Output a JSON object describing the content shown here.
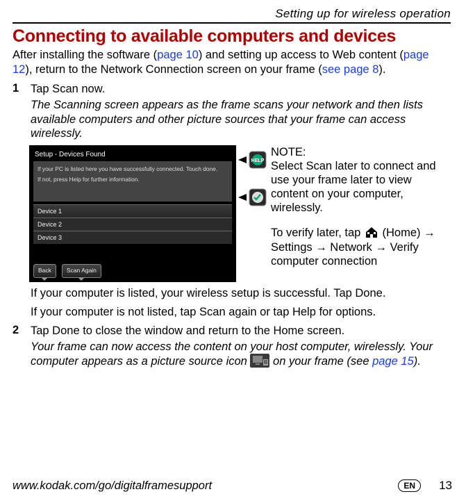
{
  "header": {
    "section": "Setting up for wireless operation"
  },
  "title": "Connecting to available computers and devices",
  "intro": {
    "pre": "After installing the software (",
    "link1": "page 10",
    "mid1": ") and setting up access to Web content (",
    "link2": "page 12",
    "mid2": "), return to the Network Connection screen on your frame (",
    "link3": "see page 8",
    "post": ")."
  },
  "steps": {
    "s1": {
      "num": "1",
      "text": "Tap Scan now."
    },
    "s1_result": "The Scanning screen appears as the frame scans your network and then lists available computers and other picture sources that your frame can access wirelessly.",
    "s2": {
      "num": "2",
      "text": "Tap Done to close the window and return to the Home screen."
    },
    "s2_result_pre": "Your frame can now access the content on your host computer, wirelessly. Your computer appears as a picture source icon ",
    "s2_result_mid": " on your frame (see ",
    "s2_result_link": "page 15",
    "s2_result_post": ")."
  },
  "shot": {
    "title": "Setup - Devices Found",
    "msg1": "If your PC is listed here you have successfully connected. Touch done.",
    "msg2": "If not, press Help for further information.",
    "dev1": "Device 1",
    "dev2": "Device 2",
    "dev3": "Device 3",
    "back": "Back",
    "scan": "Scan Again"
  },
  "side": {
    "note_label": "NOTE:",
    "note_text": "Select Scan later to connect and use your frame later to view content on your computer, wirelessly.",
    "verify_pre": "To verify later, tap ",
    "verify_home": " (Home) → Settings → Network → Verify computer connection"
  },
  "after": {
    "line1": "If your computer is listed, your wireless setup is successful. Tap Done.",
    "line2": "If your computer is not listed, tap Scan again or tap Help for options."
  },
  "footer": {
    "url": "www.kodak.com/go/digitalframesupport",
    "lang": "EN",
    "page": "13"
  }
}
